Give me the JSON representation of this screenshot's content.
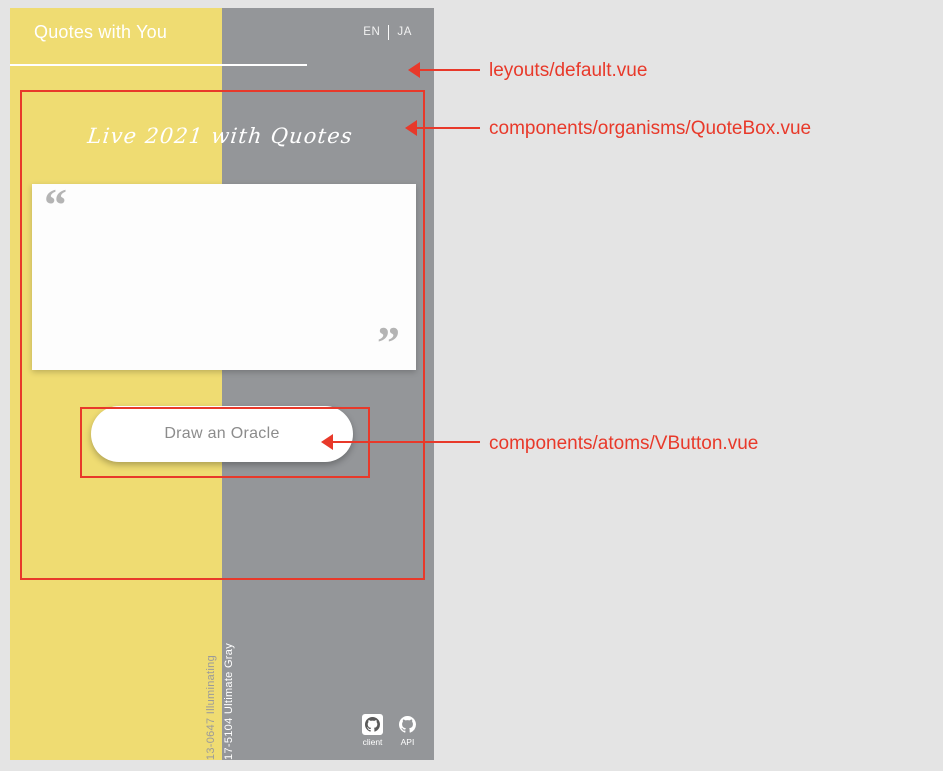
{
  "page": {
    "background_color": "#e4e4e4"
  },
  "app": {
    "yellow": "#efdc72",
    "gray": "#949699",
    "header": {
      "title": "Quotes with You",
      "languages": [
        {
          "code": "EN"
        },
        {
          "code": "JA"
        }
      ]
    },
    "quote_box": {
      "title": "Live 2021 with Quotes",
      "open_quote_glyph": "“",
      "close_quote_glyph": "”",
      "quote_text": "",
      "button_label": "Draw an Oracle"
    },
    "footer": {
      "pantone": [
        {
          "code_name": "13-0647 Illuminating"
        },
        {
          "code_name": "17-5104 Ultimate Gray"
        }
      ],
      "repo_links": [
        {
          "caption": "client",
          "icon": "github-icon"
        },
        {
          "caption": "API",
          "icon": "github-icon"
        }
      ]
    }
  },
  "annotations": {
    "color": "#e8392a",
    "items": [
      {
        "label": "leyouts/default.vue"
      },
      {
        "label": "components/organisms/QuoteBox.vue"
      },
      {
        "label": "components/atoms/VButton.vue"
      }
    ]
  }
}
